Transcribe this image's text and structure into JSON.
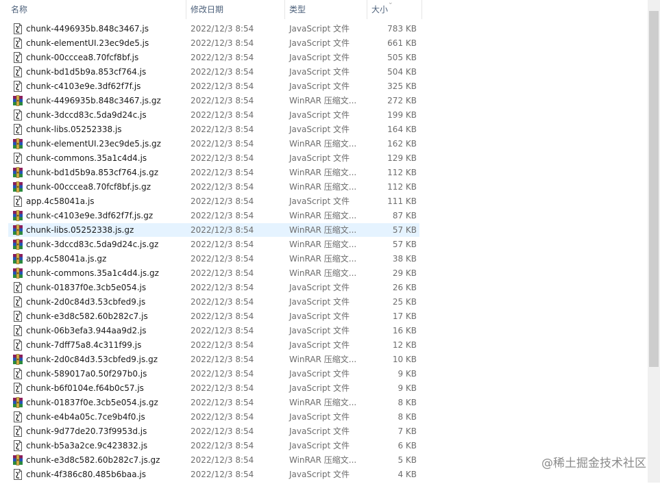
{
  "columns": {
    "name": "名称",
    "date": "修改日期",
    "type": "类型",
    "size": "大小"
  },
  "watermark": "@稀土掘金技术社区",
  "selected_index": 14,
  "files": [
    {
      "name": "chunk-4496935b.848c3467.js",
      "date": "2022/12/3 8:54",
      "type": "JavaScript 文件",
      "size": "783 KB",
      "icon": "js-file-icon"
    },
    {
      "name": "chunk-elementUI.23ec9de5.js",
      "date": "2022/12/3 8:54",
      "type": "JavaScript 文件",
      "size": "661 KB",
      "icon": "js-file-icon"
    },
    {
      "name": "chunk-00cccea8.70fcf8bf.js",
      "date": "2022/12/3 8:54",
      "type": "JavaScript 文件",
      "size": "505 KB",
      "icon": "js-file-icon"
    },
    {
      "name": "chunk-bd1d5b9a.853cf764.js",
      "date": "2022/12/3 8:54",
      "type": "JavaScript 文件",
      "size": "504 KB",
      "icon": "js-file-icon"
    },
    {
      "name": "chunk-c4103e9e.3df62f7f.js",
      "date": "2022/12/3 8:54",
      "type": "JavaScript 文件",
      "size": "325 KB",
      "icon": "js-file-icon"
    },
    {
      "name": "chunk-4496935b.848c3467.js.gz",
      "date": "2022/12/3 8:54",
      "type": "WinRAR 压缩文...",
      "size": "272 KB",
      "icon": "winrar-archive-icon"
    },
    {
      "name": "chunk-3dccd83c.5da9d24c.js",
      "date": "2022/12/3 8:54",
      "type": "JavaScript 文件",
      "size": "199 KB",
      "icon": "js-file-icon"
    },
    {
      "name": "chunk-libs.05252338.js",
      "date": "2022/12/3 8:54",
      "type": "JavaScript 文件",
      "size": "164 KB",
      "icon": "js-file-icon"
    },
    {
      "name": "chunk-elementUI.23ec9de5.js.gz",
      "date": "2022/12/3 8:54",
      "type": "WinRAR 压缩文...",
      "size": "162 KB",
      "icon": "winrar-archive-icon"
    },
    {
      "name": "chunk-commons.35a1c4d4.js",
      "date": "2022/12/3 8:54",
      "type": "JavaScript 文件",
      "size": "129 KB",
      "icon": "js-file-icon"
    },
    {
      "name": "chunk-bd1d5b9a.853cf764.js.gz",
      "date": "2022/12/3 8:54",
      "type": "WinRAR 压缩文...",
      "size": "112 KB",
      "icon": "winrar-archive-icon"
    },
    {
      "name": "chunk-00cccea8.70fcf8bf.js.gz",
      "date": "2022/12/3 8:54",
      "type": "WinRAR 压缩文...",
      "size": "112 KB",
      "icon": "winrar-archive-icon"
    },
    {
      "name": "app.4c58041a.js",
      "date": "2022/12/3 8:54",
      "type": "JavaScript 文件",
      "size": "111 KB",
      "icon": "js-file-icon"
    },
    {
      "name": "chunk-c4103e9e.3df62f7f.js.gz",
      "date": "2022/12/3 8:54",
      "type": "WinRAR 压缩文...",
      "size": "87 KB",
      "icon": "winrar-archive-icon"
    },
    {
      "name": "chunk-libs.05252338.js.gz",
      "date": "2022/12/3 8:54",
      "type": "WinRAR 压缩文...",
      "size": "57 KB",
      "icon": "winrar-archive-icon"
    },
    {
      "name": "chunk-3dccd83c.5da9d24c.js.gz",
      "date": "2022/12/3 8:54",
      "type": "WinRAR 压缩文...",
      "size": "57 KB",
      "icon": "winrar-archive-icon"
    },
    {
      "name": "app.4c58041a.js.gz",
      "date": "2022/12/3 8:54",
      "type": "WinRAR 压缩文...",
      "size": "38 KB",
      "icon": "winrar-archive-icon"
    },
    {
      "name": "chunk-commons.35a1c4d4.js.gz",
      "date": "2022/12/3 8:54",
      "type": "WinRAR 压缩文...",
      "size": "29 KB",
      "icon": "winrar-archive-icon"
    },
    {
      "name": "chunk-01837f0e.3cb5e054.js",
      "date": "2022/12/3 8:54",
      "type": "JavaScript 文件",
      "size": "26 KB",
      "icon": "js-file-icon"
    },
    {
      "name": "chunk-2d0c84d3.53cbfed9.js",
      "date": "2022/12/3 8:54",
      "type": "JavaScript 文件",
      "size": "25 KB",
      "icon": "js-file-icon"
    },
    {
      "name": "chunk-e3d8c582.60b282c7.js",
      "date": "2022/12/3 8:54",
      "type": "JavaScript 文件",
      "size": "17 KB",
      "icon": "js-file-icon"
    },
    {
      "name": "chunk-06b3efa3.944aa9d2.js",
      "date": "2022/12/3 8:54",
      "type": "JavaScript 文件",
      "size": "16 KB",
      "icon": "js-file-icon"
    },
    {
      "name": "chunk-7dff75a8.4c311f99.js",
      "date": "2022/12/3 8:54",
      "type": "JavaScript 文件",
      "size": "12 KB",
      "icon": "js-file-icon"
    },
    {
      "name": "chunk-2d0c84d3.53cbfed9.js.gz",
      "date": "2022/12/3 8:54",
      "type": "WinRAR 压缩文...",
      "size": "10 KB",
      "icon": "winrar-archive-icon"
    },
    {
      "name": "chunk-589017a0.50f297b0.js",
      "date": "2022/12/3 8:54",
      "type": "JavaScript 文件",
      "size": "9 KB",
      "icon": "js-file-icon"
    },
    {
      "name": "chunk-b6f0104e.f64b0c57.js",
      "date": "2022/12/3 8:54",
      "type": "JavaScript 文件",
      "size": "9 KB",
      "icon": "js-file-icon"
    },
    {
      "name": "chunk-01837f0e.3cb5e054.js.gz",
      "date": "2022/12/3 8:54",
      "type": "WinRAR 压缩文...",
      "size": "8 KB",
      "icon": "winrar-archive-icon"
    },
    {
      "name": "chunk-e4b4a05c.7ce9b4f0.js",
      "date": "2022/12/3 8:54",
      "type": "JavaScript 文件",
      "size": "8 KB",
      "icon": "js-file-icon"
    },
    {
      "name": "chunk-9d77de20.73f9953d.js",
      "date": "2022/12/3 8:54",
      "type": "JavaScript 文件",
      "size": "7 KB",
      "icon": "js-file-icon"
    },
    {
      "name": "chunk-b5a3a2ce.9c423832.js",
      "date": "2022/12/3 8:54",
      "type": "JavaScript 文件",
      "size": "6 KB",
      "icon": "js-file-icon"
    },
    {
      "name": "chunk-e3d8c582.60b282c7.js.gz",
      "date": "2022/12/3 8:54",
      "type": "WinRAR 压缩文...",
      "size": "5 KB",
      "icon": "winrar-archive-icon"
    },
    {
      "name": "chunk-4f386c80.485b6baa.js",
      "date": "2022/12/3 8:54",
      "type": "JavaScript 文件",
      "size": "4 KB",
      "icon": "js-file-icon"
    }
  ]
}
